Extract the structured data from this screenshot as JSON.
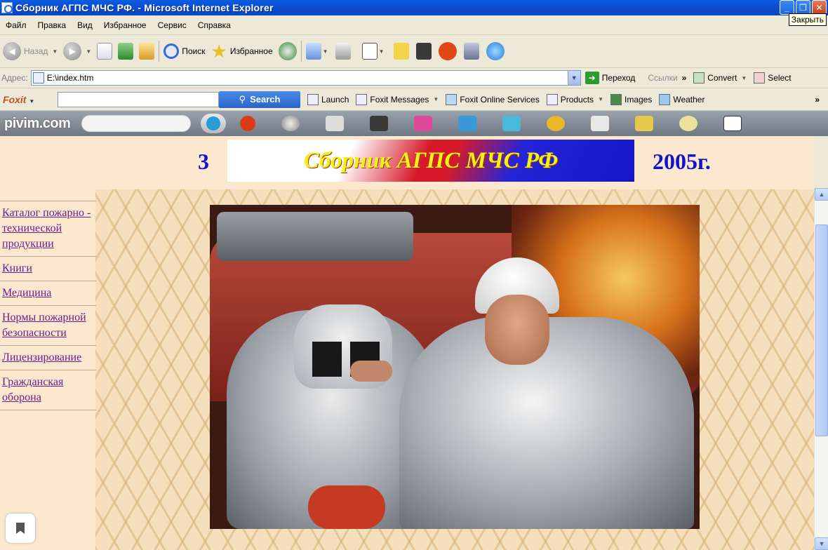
{
  "window": {
    "title": "Сборник АГПС МЧС РФ. - Microsoft Internet Explorer",
    "close_tooltip": "Закрыть"
  },
  "menu": [
    "Файл",
    "Правка",
    "Вид",
    "Избранное",
    "Сервис",
    "Справка"
  ],
  "toolbar": {
    "back_label": "Назад",
    "search_label": "Поиск",
    "favorites_label": "Избранное"
  },
  "address": {
    "label": "Адрес:",
    "value": "E:\\index.htm",
    "go_label": "Переход",
    "links_label": "Ссылки",
    "convert_label": "Convert",
    "select_label": "Select"
  },
  "foxit": {
    "logo": "Foxit",
    "search_label": "Search",
    "items": [
      "Launch",
      "Foxit Messages",
      "Foxit Online Services",
      "Products",
      "Images",
      "Weather"
    ]
  },
  "pivim": {
    "logo": "pivim.com"
  },
  "page": {
    "banner_number": "3",
    "banner_title": "Сборник АГПС МЧС РФ",
    "banner_year": "2005г.",
    "nav": [
      "Каталог пожарно - технической продукции",
      "Книги",
      "Медицина",
      "Нормы пожарной безопасности",
      "Лицензирование",
      "Гражданская оборона"
    ]
  },
  "colors": {
    "title_bar": "#0b4ed3",
    "page_bg": "#fbe8cf",
    "link": "#6b1e8a",
    "banner_text": "#1212c8",
    "banner_title_text": "#f5f018"
  }
}
